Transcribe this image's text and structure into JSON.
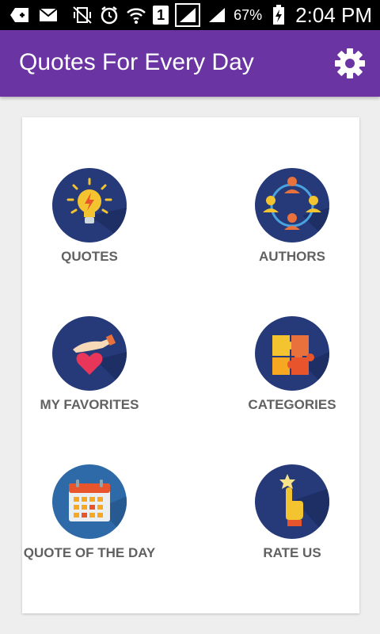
{
  "status_bar": {
    "battery_percent": "67%",
    "time": "2:04 PM",
    "sim_slot": "1",
    "icons": [
      "add-icon",
      "mail-icon",
      "no-vibrate-icon",
      "alarm-icon",
      "wifi-icon",
      "sim-1-icon",
      "signal-icon",
      "signal-2-icon",
      "battery-charging-icon"
    ]
  },
  "app_bar": {
    "title": "Quotes For Every Day",
    "settings_icon": "gear-icon",
    "color": "#6a35a2"
  },
  "menu": {
    "items": [
      {
        "label": "QUOTES",
        "icon": "lightbulb-icon"
      },
      {
        "label": "AUTHORS",
        "icon": "people-network-icon"
      },
      {
        "label": "MY FAVORITES",
        "icon": "heart-hand-icon"
      },
      {
        "label": "CATEGORIES",
        "icon": "puzzle-icon"
      },
      {
        "label": "QUOTE OF THE DAY",
        "icon": "calendar-icon"
      },
      {
        "label": "RATE US",
        "icon": "star-hand-icon"
      }
    ]
  },
  "colors": {
    "circle_navy": "#263a7a",
    "circle_blue": "#2e6aa8",
    "label_gray": "#616161"
  }
}
